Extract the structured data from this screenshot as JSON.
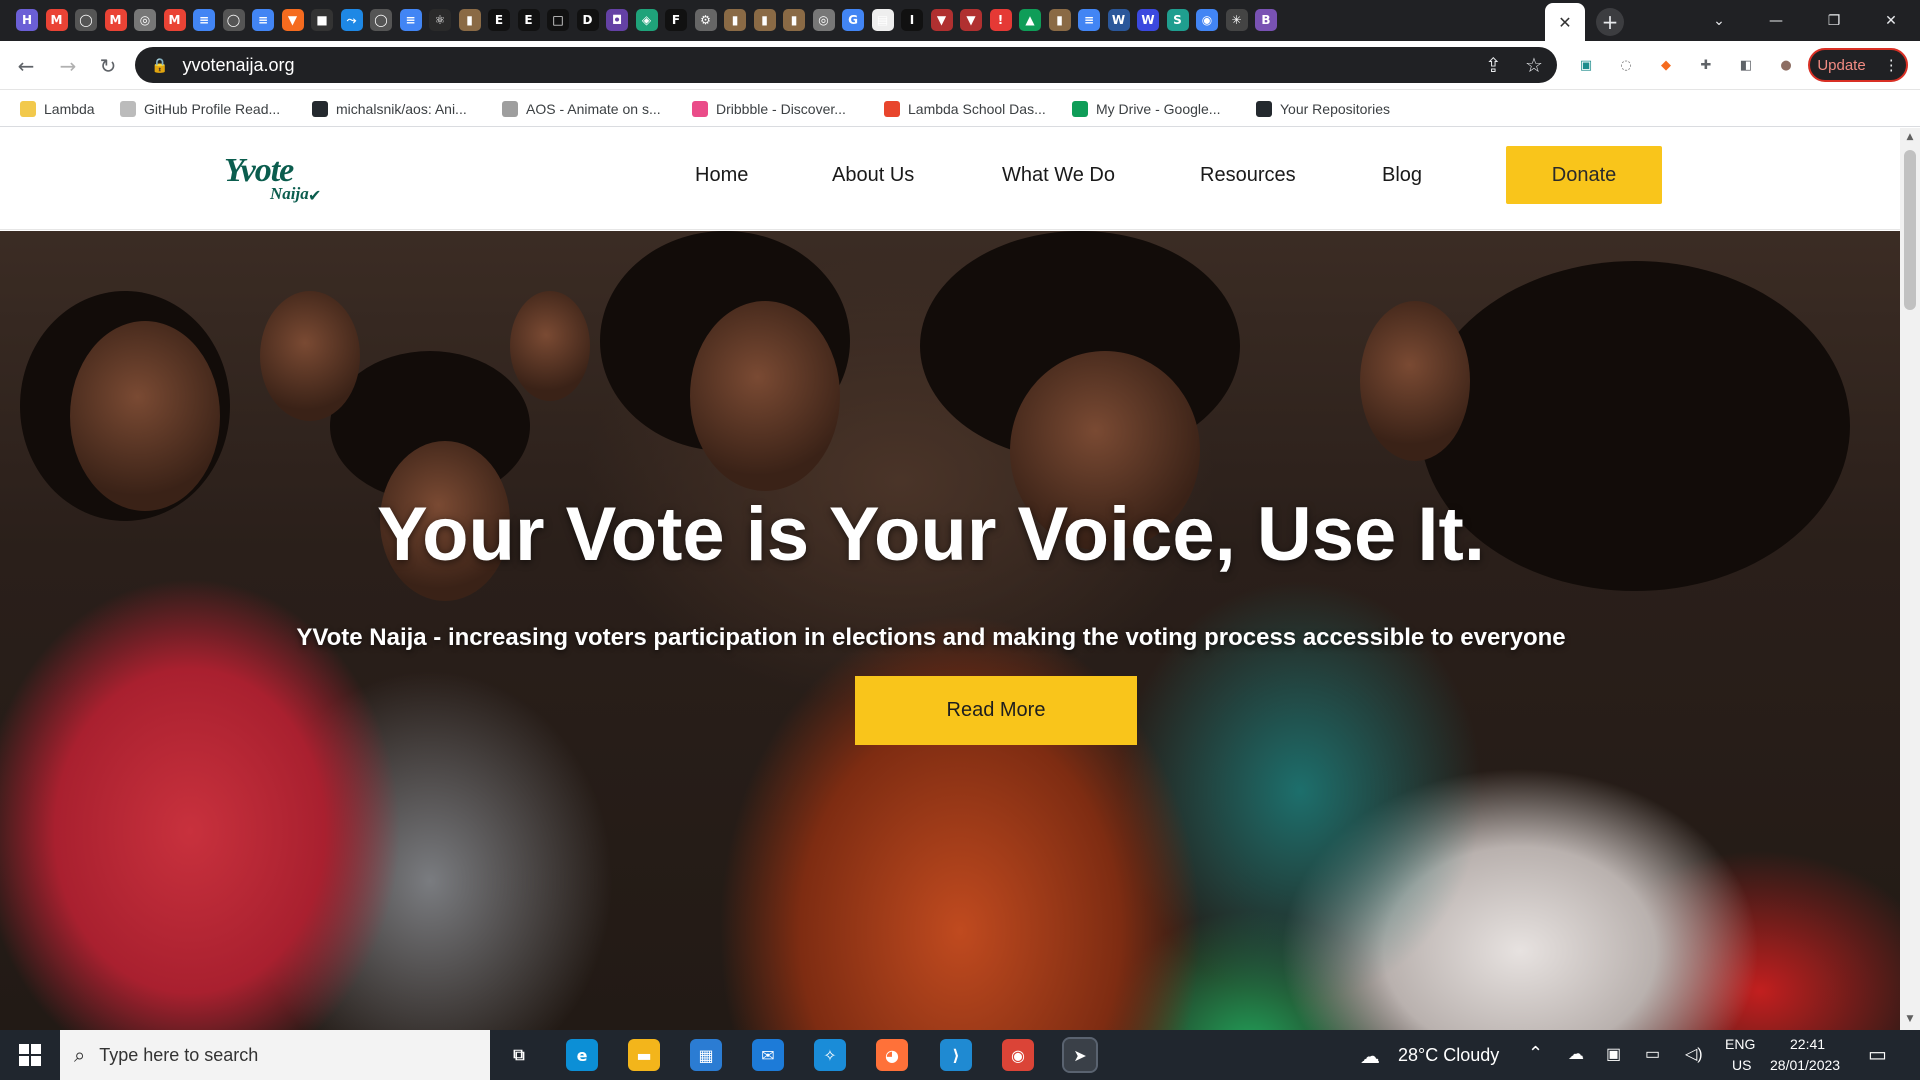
{
  "browser": {
    "tab_favicons": [
      {
        "name": "hashnode-icon",
        "glyph": "H",
        "color": "#6b5fd6"
      },
      {
        "name": "gmail-icon",
        "glyph": "M",
        "color": "#ea4335"
      },
      {
        "name": "github-icon",
        "glyph": "◯",
        "color": "#555"
      },
      {
        "name": "gmail-icon",
        "glyph": "M",
        "color": "#ea4335"
      },
      {
        "name": "globe-icon",
        "glyph": "◎",
        "color": "#777"
      },
      {
        "name": "gmail-icon",
        "glyph": "M",
        "color": "#ea4335"
      },
      {
        "name": "docs-icon",
        "glyph": "≡",
        "color": "#4285f4"
      },
      {
        "name": "github-icon",
        "glyph": "◯",
        "color": "#555"
      },
      {
        "name": "docs-icon",
        "glyph": "≡",
        "color": "#4285f4"
      },
      {
        "name": "brave-icon",
        "glyph": "▼",
        "color": "#f56b1f"
      },
      {
        "name": "tab-icon",
        "glyph": "■",
        "color": "#333"
      },
      {
        "name": "code-icon",
        "glyph": "⤳",
        "color": "#1e88e5"
      },
      {
        "name": "github-icon",
        "glyph": "◯",
        "color": "#555"
      },
      {
        "name": "docs-icon",
        "glyph": "≡",
        "color": "#4285f4"
      },
      {
        "name": "react-icon",
        "glyph": "⚛",
        "color": "#2a2a2a"
      },
      {
        "name": "notion-icon",
        "glyph": "▮",
        "color": "#8a6a45"
      },
      {
        "name": "e-icon",
        "glyph": "E",
        "color": "#111"
      },
      {
        "name": "e-icon",
        "glyph": "E",
        "color": "#111"
      },
      {
        "name": "square-icon",
        "glyph": "□",
        "color": "#111"
      },
      {
        "name": "dev-icon",
        "glyph": "D",
        "color": "#111"
      },
      {
        "name": "twitch-icon",
        "glyph": "◘",
        "color": "#6441a5"
      },
      {
        "name": "layers-icon",
        "glyph": "◈",
        "color": "#1fa37a"
      },
      {
        "name": "onlyfans-icon",
        "glyph": "F",
        "color": "#111"
      },
      {
        "name": "gear-icon",
        "glyph": "⚙",
        "color": "#666"
      },
      {
        "name": "notion-icon",
        "glyph": "▮",
        "color": "#8a6a45"
      },
      {
        "name": "notion-icon",
        "glyph": "▮",
        "color": "#8a6a45"
      },
      {
        "name": "notion-icon",
        "glyph": "▮",
        "color": "#8a6a45"
      },
      {
        "name": "globe-icon",
        "glyph": "◎",
        "color": "#777"
      },
      {
        "name": "google-icon",
        "glyph": "G",
        "color": "#4285f4"
      },
      {
        "name": "page-icon",
        "glyph": "▤",
        "color": "#eee"
      },
      {
        "name": "io-icon",
        "glyph": "I",
        "color": "#111"
      },
      {
        "name": "brave-icon",
        "glyph": "▼",
        "color": "#b03030"
      },
      {
        "name": "brave-icon",
        "glyph": "▼",
        "color": "#b03030"
      },
      {
        "name": "alert-icon",
        "glyph": "!",
        "color": "#e53935"
      },
      {
        "name": "drive-icon",
        "glyph": "▲",
        "color": "#0f9d58"
      },
      {
        "name": "notion-icon",
        "glyph": "▮",
        "color": "#8a6a45"
      },
      {
        "name": "docs-icon",
        "glyph": "≡",
        "color": "#4285f4"
      },
      {
        "name": "word-icon",
        "glyph": "W",
        "color": "#2b579a"
      },
      {
        "name": "word-icon",
        "glyph": "W",
        "color": "#3b49df"
      },
      {
        "name": "s-icon",
        "glyph": "S",
        "color": "#1f9e8f"
      },
      {
        "name": "chrome-icon",
        "glyph": "◉",
        "color": "#4285f4"
      },
      {
        "name": "settings-icon",
        "glyph": "✳",
        "color": "#444"
      },
      {
        "name": "bootstrap-icon",
        "glyph": "B",
        "color": "#7952b3"
      }
    ],
    "active_tab_close": "✕",
    "new_tab": "+",
    "window_controls": {
      "dropdown": "⌄",
      "minimize": "—",
      "maximize": "❐",
      "close": "✕"
    },
    "nav": {
      "back": "←",
      "forward": "→",
      "reload": "↻"
    },
    "url": "yvotenaija.org",
    "lock": "🔒",
    "share": "⇪",
    "star": "☆",
    "extensions": [
      {
        "name": "devtools-extension-icon",
        "glyph": "▣",
        "color": "#1f8c8c"
      },
      {
        "name": "extension-circle-icon",
        "glyph": "◌",
        "color": "#777"
      },
      {
        "name": "brave-extension-icon",
        "glyph": "◆",
        "color": "#f56b1f"
      },
      {
        "name": "puzzle-icon",
        "glyph": "✚",
        "color": "#5f6368"
      },
      {
        "name": "sidepanel-icon",
        "glyph": "◧",
        "color": "#5f6368"
      },
      {
        "name": "profile-avatar",
        "glyph": "●",
        "color": "#8d6e63"
      }
    ],
    "update_label": "Update",
    "update_menu": "⋮"
  },
  "bookmarks": [
    {
      "label": "Lambda",
      "color": "#f2c94c"
    },
    {
      "label": "GitHub Profile Read...",
      "color": "#bbbbbb"
    },
    {
      "label": "michalsnik/aos: Ani...",
      "color": "#24292e"
    },
    {
      "label": "AOS - Animate on s...",
      "color": "#9e9e9e"
    },
    {
      "label": "Dribbble - Discover...",
      "color": "#ea4c89"
    },
    {
      "label": "Lambda School Das...",
      "color": "#e8452c"
    },
    {
      "label": "My Drive - Google...",
      "color": "#0f9d58"
    },
    {
      "label": "Your Repositories",
      "color": "#24292e"
    }
  ],
  "site": {
    "logo_main": "Yvote",
    "logo_sub": "Naija",
    "nav": [
      "Home",
      "About Us",
      "What We Do",
      "Resources",
      "Blog"
    ],
    "donate": "Donate",
    "hero_title": "Your Vote is Your Voice, Use It.",
    "hero_sub": "YVote Naija - increasing voters participation in elections and making the voting process accessible to everyone",
    "read_more": "Read More",
    "accent_color": "#f9c51b",
    "brand_color": "#0b5d4e"
  },
  "taskbar": {
    "search_placeholder": "Type here to search",
    "apps": [
      {
        "name": "task-view-icon",
        "glyph": "⧉",
        "color": "transparent"
      },
      {
        "name": "edge-icon",
        "glyph": "e",
        "color": "#0c8fd6"
      },
      {
        "name": "file-explorer-icon",
        "glyph": "▬",
        "color": "#f3b51b"
      },
      {
        "name": "store-icon",
        "glyph": "▦",
        "color": "#2b7cd3"
      },
      {
        "name": "mail-icon",
        "glyph": "✉",
        "color": "#1d7bd8"
      },
      {
        "name": "safari-icon",
        "glyph": "✧",
        "color": "#1a8cd8"
      },
      {
        "name": "firefox-icon",
        "glyph": "◕",
        "color": "#ff7139"
      },
      {
        "name": "vscode-icon",
        "glyph": "⟩",
        "color": "#1f8ad2"
      },
      {
        "name": "chrome-icon",
        "glyph": "◉",
        "color": "#db4437"
      },
      {
        "name": "pointer-app-icon",
        "glyph": "➤",
        "color": "#e04444"
      }
    ],
    "weather": "28°C  Cloudy",
    "language": "ENG",
    "region": "US",
    "time": "22:41",
    "date": "28/01/2023"
  }
}
